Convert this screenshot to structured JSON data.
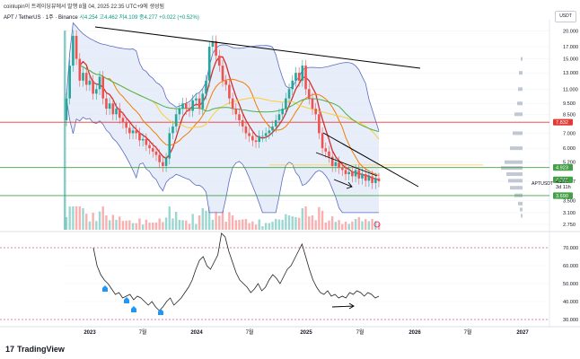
{
  "header": {
    "text": "coinlupin이 트레이딩뷰에서 발행 8월 04, 2025 22:35 UTC+9에 생성됨"
  },
  "legend": {
    "symbol": "APT / TetherUS · 1주 · Binance",
    "ohlc": "시4.254  고4.462  저4.109  종4.277  +0.022 (+0.52%)"
  },
  "currency_button": "USDT",
  "footer": {
    "brand": "TradingView",
    "brand_mark": "17"
  },
  "colors": {
    "up": "#26a69a",
    "down": "#ef5350",
    "bb": "#5b6bc0",
    "bb_fill": "#dde7f6",
    "ma_red": "#d32f2f",
    "ma_orange": "#f57c00",
    "ma_yellow": "#ffcc33",
    "ma_green": "#4caf50",
    "trendline": "#000000",
    "red_level": "#e53935",
    "green_level": "#43a047",
    "rsi_line": "#222222",
    "marker_blue": "#2196f3",
    "price_tag": "#2e7d32"
  },
  "chart_data": {
    "type": "candlestick",
    "price_axis": {
      "scale": "log",
      "ylim": [
        2.6,
        22
      ],
      "ticks": [
        "20.000",
        "17.000",
        "15.000",
        "13.000",
        "11.000",
        "9.500",
        "8.500",
        "7.000",
        "6.000",
        "5.200",
        "4.277",
        "3.500",
        "3.100",
        "2.750"
      ]
    },
    "price_labels": [
      {
        "text": "7.832",
        "value": 7.832,
        "color": "#e53935"
      },
      {
        "text": "4.923",
        "value": 4.923,
        "color": "#43a047"
      },
      {
        "text": "4.341",
        "value": 4.341,
        "color": "#43a047"
      },
      {
        "text": "4.277",
        "value": 4.277,
        "color": "#131722"
      },
      {
        "text": "3d 11h",
        "value": 4.05,
        "color": "#131722"
      },
      {
        "text": "3.690",
        "value": 3.69,
        "color": "#43a047"
      }
    ],
    "symbol_tag": "APTUSDT",
    "levels": [
      {
        "name": "resistance",
        "value": 7.832,
        "color": "#e53935"
      },
      {
        "name": "support-upper",
        "value": 4.923,
        "color": "#43a047"
      },
      {
        "name": "support-lower",
        "value": 3.69,
        "color": "#43a047"
      }
    ],
    "time_axis": [
      "2023",
      "7월",
      "2024",
      "7월",
      "2025",
      "7월",
      "2026",
      "7월",
      "2027"
    ],
    "weekly_close": [
      10.0,
      14.0,
      19.0,
      15.0,
      12.0,
      13.0,
      11.5,
      12.0,
      10.5,
      11.0,
      12.5,
      10.0,
      9.0,
      9.5,
      8.5,
      9.0,
      8.2,
      7.8,
      7.4,
      7.0,
      7.2,
      7.0,
      6.5,
      6.6,
      6.2,
      6.0,
      5.8,
      5.6,
      5.2,
      5.0,
      5.4,
      7.0,
      7.5,
      8.5,
      9.0,
      9.5,
      9.0,
      8.8,
      9.8,
      10.0,
      9.0,
      10.5,
      12.0,
      17.0,
      18.0,
      15.5,
      14.0,
      12.0,
      11.5,
      10.0,
      9.0,
      8.5,
      8.0,
      7.5,
      7.0,
      6.8,
      6.5,
      6.4,
      6.8,
      6.8,
      7.0,
      7.2,
      7.5,
      8.0,
      8.5,
      9.0,
      10.0,
      11.0,
      12.0,
      13.0,
      12.0,
      14.0,
      11.0,
      10.0,
      9.0,
      8.5,
      7.0,
      6.0,
      5.8,
      5.5,
      5.0,
      5.2,
      4.9,
      4.8,
      4.6,
      4.7,
      4.5,
      4.8,
      4.4,
      4.6,
      4.3,
      4.5,
      4.2,
      4.4,
      4.277
    ],
    "rsi_axis": {
      "ylim": [
        28,
        78
      ],
      "ticks": [
        "70.000",
        "60.000",
        "50.000",
        "40.000",
        "30.000"
      ]
    },
    "rsi": [
      70,
      60,
      55,
      52,
      50,
      47,
      44,
      45,
      42,
      43,
      44,
      41,
      43,
      42,
      40,
      38,
      40,
      37,
      35,
      37,
      40,
      42,
      38,
      40,
      42,
      45,
      48,
      52,
      58,
      63,
      65,
      60,
      58,
      62,
      66,
      78,
      76,
      68,
      62,
      56,
      52,
      50,
      48,
      45,
      47,
      50,
      46,
      48,
      52,
      55,
      53,
      50,
      54,
      58,
      60,
      64,
      68,
      72,
      65,
      58,
      52,
      48,
      45,
      44,
      46,
      43,
      44,
      42,
      43,
      42,
      45,
      44,
      46,
      45,
      43,
      45,
      44,
      42,
      43
    ]
  }
}
